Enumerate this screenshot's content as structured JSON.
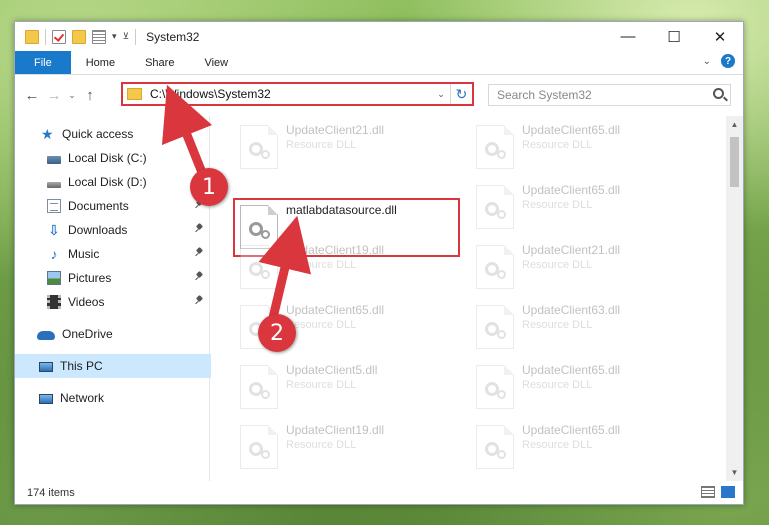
{
  "window": {
    "title": "System32",
    "controls": {
      "minimize": "—",
      "maximize": "☐",
      "close": "✕"
    }
  },
  "ribbon": {
    "tabs": [
      "File",
      "Home",
      "Share",
      "View"
    ],
    "help": "?"
  },
  "address": {
    "path": "C:\\Windows\\System32",
    "search_placeholder": "Search System32"
  },
  "sidebar": {
    "quick_access": "Quick access",
    "items": [
      {
        "label": "Local Disk (C:)",
        "pinned": false
      },
      {
        "label": "Local Disk (D:)",
        "pinned": false
      },
      {
        "label": "Documents",
        "pinned": true
      },
      {
        "label": "Downloads",
        "pinned": true
      },
      {
        "label": "Music",
        "pinned": true
      },
      {
        "label": "Pictures",
        "pinned": true
      },
      {
        "label": "Videos",
        "pinned": true
      }
    ],
    "onedrive": "OneDrive",
    "this_pc": "This PC",
    "network": "Network"
  },
  "files": [
    {
      "name": "UpdateClient21.dll",
      "type": "Resource DLL"
    },
    {
      "name": "UpdateClient65.dll",
      "type": "Resource DLL"
    },
    {
      "name": "matlabdatasource.dll",
      "type": ""
    },
    {
      "name": "UpdateClient65.dll",
      "type": "Resource DLL"
    },
    {
      "name": "UpdateClient19.dll",
      "type": "Resource DLL"
    },
    {
      "name": "UpdateClient21.dll",
      "type": "Resource DLL"
    },
    {
      "name": "UpdateClient65.dll",
      "type": "Resource DLL"
    },
    {
      "name": "UpdateClient63.dll",
      "type": "Resource DLL"
    },
    {
      "name": "UpdateClient5.dll",
      "type": "Resource DLL"
    },
    {
      "name": "UpdateClient65.dll",
      "type": "Resource DLL"
    },
    {
      "name": "UpdateClient19.dll",
      "type": "Resource DLL"
    },
    {
      "name": "UpdateClient65.dll",
      "type": "Resource DLL"
    }
  ],
  "status": {
    "count": "174 items"
  },
  "annotations": {
    "step1": "1",
    "step2": "2"
  },
  "colors": {
    "accent": "#1979ca",
    "highlight": "#d9363e",
    "selected": "#cce8ff"
  }
}
